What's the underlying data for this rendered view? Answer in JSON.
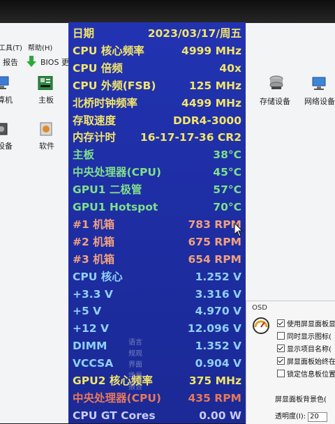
{
  "menubar": {
    "items": [
      "工具(T)",
      "帮助(H)"
    ]
  },
  "toolbar": {
    "report_label": "报告",
    "bios_label": "BIOS 更"
  },
  "devices_left": [
    {
      "label": "算机",
      "icon": "computer-icon"
    },
    {
      "label": "主板",
      "icon": "motherboard-icon"
    },
    {
      "label": "设备",
      "icon": "device-icon"
    },
    {
      "label": "软件",
      "icon": "software-icon"
    }
  ],
  "devices_right": [
    {
      "label": "存储设备",
      "icon": "storage-icon"
    },
    {
      "label": "网络设备",
      "icon": "network-icon"
    }
  ],
  "osd": {
    "title": "OSD",
    "options": [
      {
        "label": "使用屏显面板显",
        "checked": true
      },
      {
        "label": "同时显示图标(",
        "checked": false
      },
      {
        "label": "显示项目名称(",
        "checked": true
      },
      {
        "label": "屏显面板始终在",
        "checked": true
      },
      {
        "label": "锁定信息板位置",
        "checked": false
      }
    ],
    "bg_label": "屏显面板背景色(",
    "transparency_label": "透明度(I):",
    "transparency_value": "20"
  },
  "ghost_menu": [
    "语言",
    "规观",
    "界面",
    "场景",
    "报告"
  ],
  "overlay": {
    "rows": [
      {
        "label": "日期",
        "value": "2023/03/17/周五",
        "color": "#f2e56a"
      },
      {
        "label": "CPU 核心频率",
        "value": "4999 MHz",
        "color": "#f2e56a"
      },
      {
        "label": "CPU 倍频",
        "value": "40x",
        "color": "#f2e56a"
      },
      {
        "label": "CPU 外频(FSB)",
        "value": "125 MHz",
        "color": "#f2e56a"
      },
      {
        "label": "北桥时钟频率",
        "value": "4499 MHz",
        "color": "#f2e56a"
      },
      {
        "label": "存取速度",
        "value": "DDR4-3000",
        "color": "#f2e56a"
      },
      {
        "label": "内存计时",
        "value": "16-17-17-36 CR2",
        "color": "#f2e56a"
      },
      {
        "label": "主板",
        "value": "38°C",
        "color": "#7ee08a"
      },
      {
        "label": "中央处理器(CPU)",
        "value": "45°C",
        "color": "#7ee08a"
      },
      {
        "label": "GPU1 二极管",
        "value": "57°C",
        "color": "#7ee08a"
      },
      {
        "label": "GPU1 Hotspot",
        "value": "70°C",
        "color": "#7ee08a"
      },
      {
        "label": "#1 机箱",
        "value": "783 RPM",
        "color": "#f0a080"
      },
      {
        "label": "#2 机箱",
        "value": "675 RPM",
        "color": "#f0a080"
      },
      {
        "label": "#3 机箱",
        "value": "654 RPM",
        "color": "#f0a080"
      },
      {
        "label": "CPU 核心",
        "value": "1.252 V",
        "color": "#8fd0f5"
      },
      {
        "label": "+3.3 V",
        "value": "3.316 V",
        "color": "#8fd0f5"
      },
      {
        "label": "+5 V",
        "value": "4.970 V",
        "color": "#8fd0f5"
      },
      {
        "label": "+12 V",
        "value": "12.096 V",
        "color": "#8fd0f5"
      },
      {
        "label": "DIMM",
        "value": "1.352 V",
        "color": "#8fd0f5"
      },
      {
        "label": "VCCSA",
        "value": "0.904 V",
        "color": "#8fd0f5"
      },
      {
        "label": "GPU2 核心频率",
        "value": "375 MHz",
        "color": "#f2e56a"
      },
      {
        "label": "中央处理器(CPU)",
        "value": "435 RPM",
        "color": "#e8785a"
      },
      {
        "label": "CPU GT Cores",
        "value": "0.00 W",
        "color": "#c7ccf0"
      }
    ]
  }
}
